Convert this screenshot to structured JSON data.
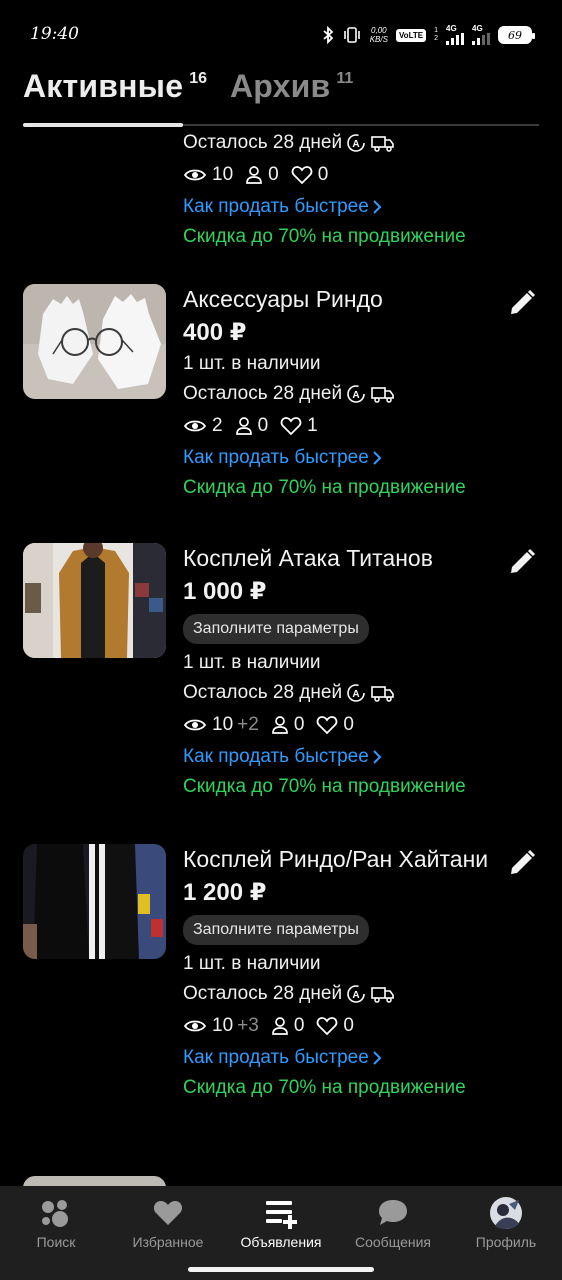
{
  "status_bar": {
    "time": "19:40",
    "net_speed_value": "0,00",
    "net_speed_unit": "KB/S",
    "volte": "VoLTE",
    "sim1_num": "1",
    "sim2_num": "2",
    "sim1_label": "4G",
    "sim2_label": "4G",
    "battery": "69"
  },
  "tabs": [
    {
      "label": "Активные",
      "count": "16"
    },
    {
      "label": "Архив",
      "count": "11"
    }
  ],
  "listings": [
    {
      "title": "",
      "price": "",
      "remaining": "Осталось 28 дней",
      "views": "10",
      "views_plus": "",
      "contacts": "0",
      "likes": "0",
      "promo_link": "Как продать быстрее",
      "discount": "Скидка до 70% на продвижение"
    },
    {
      "title": "Аксессуары Риндо",
      "price": "400 ₽",
      "stock": "1 шт. в наличии",
      "remaining": "Осталось 28 дней",
      "views": "2",
      "views_plus": "",
      "contacts": "0",
      "likes": "1",
      "promo_link": "Как продать быстрее",
      "discount": "Скидка до 70% на продвижение"
    },
    {
      "title": "Косплей Атака Титанов",
      "price": "1 000 ₽",
      "chip": "Заполните параметры",
      "stock": "1 шт. в наличии",
      "remaining": "Осталось 28 дней",
      "views": "10",
      "views_plus": "+2",
      "contacts": "0",
      "likes": "0",
      "promo_link": "Как продать быстрее",
      "discount": "Скидка до 70% на продвижение"
    },
    {
      "title": "Косплей Риндо/Ран Хайтани",
      "price": "1 200 ₽",
      "chip": "Заполните параметры",
      "stock": "1 шт. в наличии",
      "remaining": "Осталось 28 дней",
      "views": "10",
      "views_plus": "+3",
      "contacts": "0",
      "likes": "0",
      "promo_link": "Как продать быстрее",
      "discount": "Скидка до 70% на продвижение"
    }
  ],
  "bottom_nav": [
    {
      "label": "Поиск",
      "icon": "search-dots-icon"
    },
    {
      "label": "Избранное",
      "icon": "heart-icon"
    },
    {
      "label": "Объявления",
      "icon": "listings-add-icon",
      "active": true
    },
    {
      "label": "Сообщения",
      "icon": "chat-bubble-icon"
    },
    {
      "label": "Профиль",
      "icon": "avatar"
    }
  ],
  "colors": {
    "background": "#000000",
    "link_blue": "#2f9bff",
    "discount_green": "#2fd35a",
    "nav_background": "#1f1f1f"
  }
}
